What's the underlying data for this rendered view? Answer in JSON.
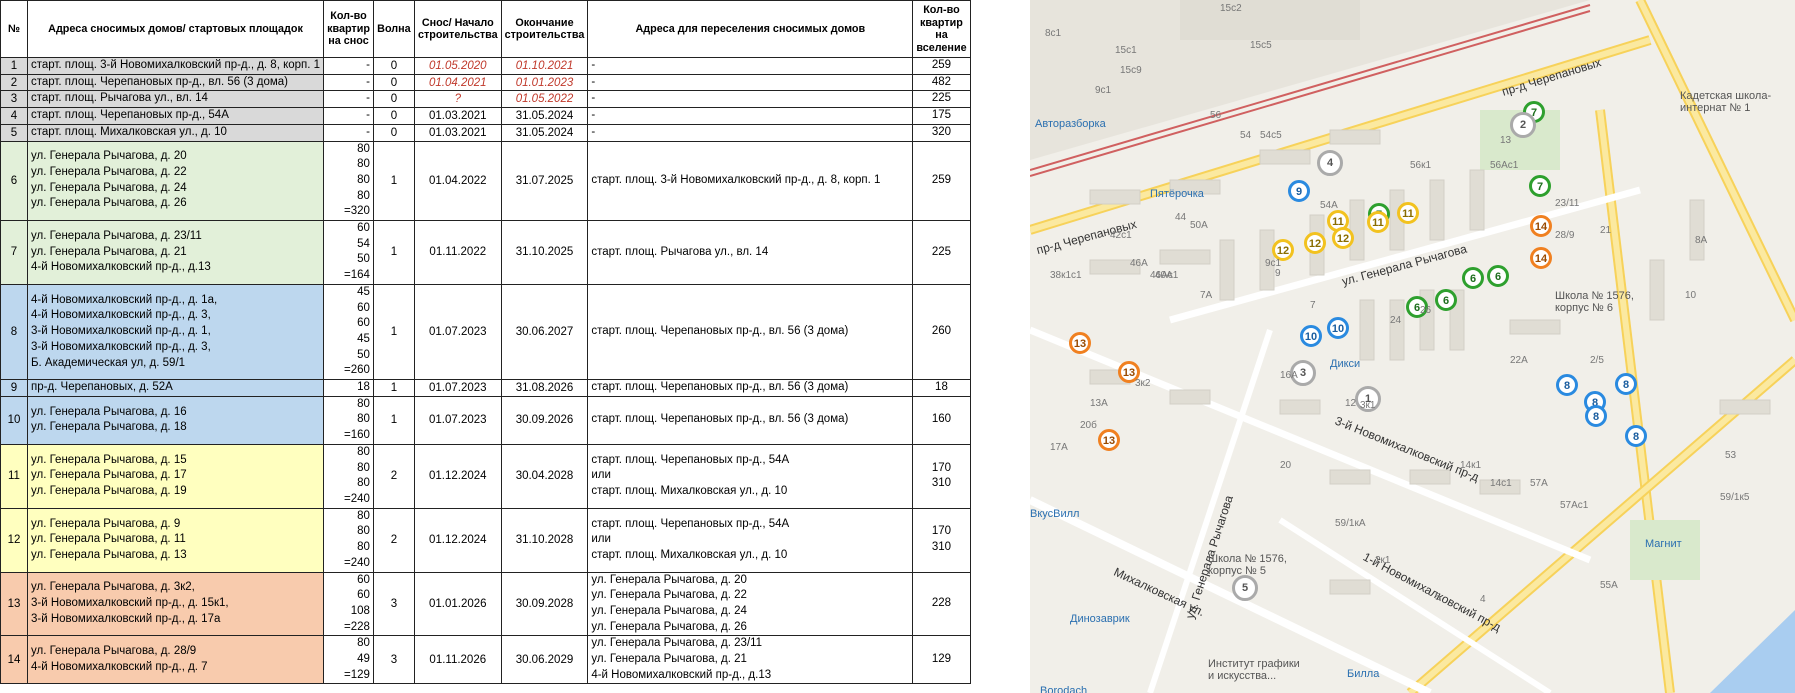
{
  "table": {
    "headers": {
      "num": "№",
      "addr": "Адреса сносимых домов/ стартовых площадок",
      "qty": "Кол-во квартир на снос",
      "wave": "Волна",
      "start": "Снос/ Начало строительства",
      "end": "Окончание строительства",
      "reloc": "Адреса для переселения сносимых домов",
      "qtyin": "Кол-во квартир на вселение"
    },
    "rows": [
      {
        "num": "1",
        "addr": [
          "старт. площ. 3-й Новомихалковский пр-д., д. 8, корп. 1"
        ],
        "qty": [
          "-"
        ],
        "wave": "0",
        "start": "01.05.2020",
        "end": "01.10.2021",
        "reloc": [
          "-"
        ],
        "qtyin": [
          "259"
        ],
        "color": "g",
        "red": true
      },
      {
        "num": "2",
        "addr": [
          "старт. площ. Черепановых пр-д., вл. 56 (3 дома)"
        ],
        "qty": [
          "-"
        ],
        "wave": "0",
        "start": "01.04.2021",
        "end": "01.01.2023",
        "reloc": [
          "-"
        ],
        "qtyin": [
          "482"
        ],
        "color": "g",
        "red": true
      },
      {
        "num": "3",
        "addr": [
          "старт. площ. Рычагова ул., вл. 14"
        ],
        "qty": [
          "-"
        ],
        "wave": "0",
        "start": "?",
        "end": "01.05.2022",
        "reloc": [
          "-"
        ],
        "qtyin": [
          "225"
        ],
        "color": "g",
        "red": true
      },
      {
        "num": "4",
        "addr": [
          "старт. площ. Черепановых пр-д., 54А"
        ],
        "qty": [
          "-"
        ],
        "wave": "0",
        "start": "01.03.2021",
        "end": "31.05.2024",
        "reloc": [
          "-"
        ],
        "qtyin": [
          "175"
        ],
        "color": "g",
        "red": false
      },
      {
        "num": "5",
        "addr": [
          "старт. площ. Михалковская ул., д. 10"
        ],
        "qty": [
          "-"
        ],
        "wave": "0",
        "start": "01.03.2021",
        "end": "31.05.2024",
        "reloc": [
          "-"
        ],
        "qtyin": [
          "320"
        ],
        "color": "g",
        "red": false
      },
      {
        "num": "6",
        "addr": [
          "ул. Генерала Рычагова, д. 20",
          "ул. Генерала Рычагова, д. 22",
          "ул. Генерала Рычагова, д. 24",
          "ул. Генерала Рычагова, д. 26",
          ""
        ],
        "qty": [
          "80",
          "80",
          "80",
          "80",
          "=320"
        ],
        "wave": "1",
        "start": "01.04.2022",
        "end": "31.07.2025",
        "reloc": [
          "старт. площ. 3-й Новомихалковский пр-д., д. 8, корп. 1"
        ],
        "qtyin": [
          "259"
        ],
        "color": "gr",
        "red": false
      },
      {
        "num": "7",
        "addr": [
          "ул. Генерала Рычагова, д. 23/11",
          "ул. Генерала Рычагова, д. 21",
          "4-й Новомихалковский пр-д., д.13",
          ""
        ],
        "qty": [
          "60",
          "54",
          "50",
          "=164"
        ],
        "wave": "1",
        "start": "01.11.2022",
        "end": "31.10.2025",
        "reloc": [
          "старт. площ. Рычагова ул., вл. 14"
        ],
        "qtyin": [
          "225"
        ],
        "color": "gr",
        "red": false
      },
      {
        "num": "8",
        "addr": [
          "4-й Новомихалковский пр-д., д. 1а,",
          "4-й Новомихалковский пр-д., д. 3,",
          "3-й Новомихалковский пр-д., д. 1,",
          "3-й Новомихалковский пр-д., д. 3,",
          "Б. Академическая ул, д. 59/1",
          ""
        ],
        "qty": [
          "45",
          "60",
          "60",
          "45",
          "50",
          "=260"
        ],
        "wave": "1",
        "start": "01.07.2023",
        "end": "30.06.2027",
        "reloc": [
          "старт. площ. Черепановых пр-д., вл. 56 (3 дома)"
        ],
        "qtyin": [
          "260"
        ],
        "color": "bl",
        "red": false
      },
      {
        "num": "9",
        "addr": [
          "пр-д. Черепановых, д. 52А"
        ],
        "qty": [
          "18"
        ],
        "wave": "1",
        "start": "01.07.2023",
        "end": "31.08.2026",
        "reloc": [
          "старт. площ. Черепановых пр-д., вл. 56 (3 дома)"
        ],
        "qtyin": [
          "18"
        ],
        "color": "bl",
        "red": false
      },
      {
        "num": "10",
        "addr": [
          "ул. Генерала Рычагова, д. 16",
          "ул. Генерала Рычагова, д. 18",
          ""
        ],
        "qty": [
          "80",
          "80",
          "=160"
        ],
        "wave": "1",
        "start": "01.07.2023",
        "end": "30.09.2026",
        "reloc": [
          "старт. площ. Черепановых пр-д., вл. 56 (3 дома)"
        ],
        "qtyin": [
          "160"
        ],
        "color": "bl",
        "red": false
      },
      {
        "num": "11",
        "addr": [
          "ул. Генерала Рычагова, д. 15",
          "ул. Генерала Рычагова, д. 17",
          "ул. Генерала Рычагова, д. 19",
          ""
        ],
        "qty": [
          "80",
          "80",
          "80",
          "=240"
        ],
        "wave": "2",
        "start": "01.12.2024",
        "end": "30.04.2028",
        "reloc": [
          "старт. площ. Черепановых пр-д., 54А",
          "или",
          "старт. площ. Михалковская ул., д. 10"
        ],
        "qtyin": [
          "170",
          "",
          "310"
        ],
        "color": "ye",
        "red": false
      },
      {
        "num": "12",
        "addr": [
          "ул. Генерала Рычагова, д. 9",
          "ул. Генерала Рычагова, д. 11",
          "ул. Генерала Рычагова, д. 13",
          ""
        ],
        "qty": [
          "80",
          "80",
          "80",
          "=240"
        ],
        "wave": "2",
        "start": "01.12.2024",
        "end": "31.10.2028",
        "reloc": [
          "старт. площ. Черепановых пр-д., 54А",
          "или",
          "старт. площ. Михалковская ул., д. 10"
        ],
        "qtyin": [
          "170",
          "",
          "310"
        ],
        "color": "ye",
        "red": false
      },
      {
        "num": "13",
        "addr": [
          "ул. Генерала Рычагова, д. 3к2,",
          "3-й Новомихалковский пр-д., д. 15к1,",
          "3-й Новомихалковский пр-д., д. 17а",
          ""
        ],
        "qty": [
          "60",
          "60",
          "108",
          "=228"
        ],
        "wave": "3",
        "start": "01.01.2026",
        "end": "30.09.2028",
        "reloc": [
          "ул. Генерала Рычагова, д. 20",
          "ул. Генерала Рычагова, д. 22",
          "ул. Генерала Рычагова, д. 24",
          "ул. Генерала Рычагова, д. 26"
        ],
        "qtyin": [
          "228"
        ],
        "color": "or",
        "red": false
      },
      {
        "num": "14",
        "addr": [
          "ул. Генерала Рычагова, д. 28/9",
          "4-й Новомихалковский пр-д., д. 7",
          ""
        ],
        "qty": [
          "80",
          "49",
          "=129"
        ],
        "wave": "3",
        "start": "01.11.2026",
        "end": "30.06.2029",
        "reloc": [
          "ул. Генерала Рычагова, д. 23/11",
          "ул. Генерала Рычагова, д. 21",
          "4-й Новомихалковский пр-д., д.13"
        ],
        "qtyin": [
          "129"
        ],
        "color": "or",
        "red": false
      }
    ]
  },
  "map": {
    "streets": [
      "пр-д Черепановых",
      "пр-д Черепановых",
      "ул. Генерала Рычагова",
      "3-й Новомихалковский пр-д",
      "ул. Генерала Рычагова",
      "Михалковская ул.",
      "1-й Новомихалковский пр-д"
    ],
    "pois": [
      "Авторазборка",
      "Пятёрочка",
      "Кадетская школа-интернат № 1",
      "Школа № 1576, корпус № 6",
      "Дикси",
      "ВкусВилл",
      "Школа № 1576, корпус № 5",
      "Магнит",
      "Динозаврик",
      "Институт графики и искусства...",
      "Билла",
      "Borodach"
    ],
    "pins": [
      {
        "label": "7",
        "color": "green"
      },
      {
        "label": "7",
        "color": "green"
      },
      {
        "label": "7",
        "color": "green"
      },
      {
        "label": "6",
        "color": "green"
      },
      {
        "label": "6",
        "color": "green"
      },
      {
        "label": "6",
        "color": "green"
      },
      {
        "label": "6",
        "color": "green"
      },
      {
        "label": "9",
        "color": "blue"
      },
      {
        "label": "10",
        "color": "blue"
      },
      {
        "label": "10",
        "color": "blue"
      },
      {
        "label": "8",
        "color": "blue"
      },
      {
        "label": "8",
        "color": "blue"
      },
      {
        "label": "8",
        "color": "blue"
      },
      {
        "label": "8",
        "color": "blue"
      },
      {
        "label": "8",
        "color": "blue"
      },
      {
        "label": "11",
        "color": "yellow"
      },
      {
        "label": "11",
        "color": "yellow"
      },
      {
        "label": "11",
        "color": "yellow"
      },
      {
        "label": "12",
        "color": "yellow"
      },
      {
        "label": "12",
        "color": "yellow"
      },
      {
        "label": "12",
        "color": "yellow"
      },
      {
        "label": "13",
        "color": "orange"
      },
      {
        "label": "13",
        "color": "orange"
      },
      {
        "label": "13",
        "color": "orange"
      },
      {
        "label": "14",
        "color": "orange"
      },
      {
        "label": "14",
        "color": "orange"
      },
      {
        "label": "2",
        "color": "gray"
      },
      {
        "label": "4",
        "color": "gray"
      },
      {
        "label": "3",
        "color": "gray"
      },
      {
        "label": "1",
        "color": "gray"
      },
      {
        "label": "5",
        "color": "gray"
      }
    ],
    "house_numbers": [
      "8с1",
      "15с2",
      "15с1",
      "15с9",
      "15с5",
      "9с1",
      "56",
      "54",
      "54с5",
      "56к1",
      "56Ас1",
      "54А",
      "42с1",
      "46А",
      "46Ас1",
      "40А",
      "38к1с1",
      "50А",
      "44",
      "9",
      "9с1",
      "7А",
      "22А",
      "13",
      "2/5",
      "8А",
      "13А",
      "17А",
      "20б",
      "3к2",
      "3к1",
      "16А",
      "12",
      "10",
      "20",
      "14с1",
      "57А",
      "57Ас1",
      "55А",
      "53",
      "59/1к5",
      "59/1кА",
      "5",
      "2к1",
      "4",
      "14к1",
      "28/9",
      "23/11",
      "21",
      "7",
      "24",
      "26"
    ]
  },
  "colors": {
    "gray": "#d9d9d9",
    "green": "#e2f0d9",
    "blue": "#bdd7ee",
    "yellow": "#ffffbf",
    "orange": "#f8cbad",
    "red_text": "#c0392b"
  }
}
